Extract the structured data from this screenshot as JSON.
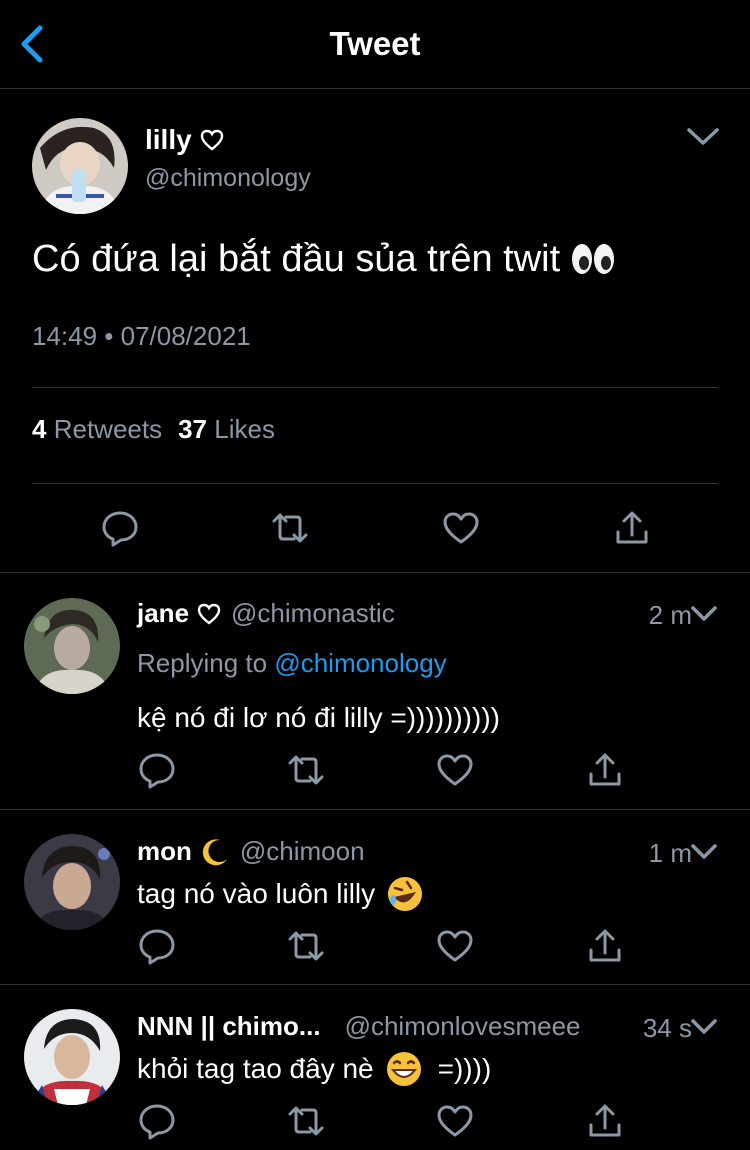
{
  "header": {
    "title": "Tweet"
  },
  "main_tweet": {
    "name": "lilly",
    "handle": "@chimonology",
    "text": "Có đứa lại bắt đầu sủa trên twit",
    "emoji": "eyes-emoji",
    "timestamp": "14:49 • 07/08/2021",
    "retweets_count": "4",
    "retweets_label": "Retweets",
    "likes_count": "37",
    "likes_label": "Likes"
  },
  "replies": [
    {
      "name": "jane",
      "handle": "@chimonastic",
      "time": "2 m",
      "replying_prefix": "Replying to",
      "replying_to": "@chimonology",
      "text": "kệ nó đi lơ nó đi lilly =))))))))))"
    },
    {
      "name": "mon",
      "handle": "@chimoon",
      "time": "1 m",
      "text": "tag nó vào luôn lilly",
      "emoji": "rofl-emoji"
    },
    {
      "name": "NNN || chimo...",
      "handle": "@chimonlovesmeee",
      "time": "34 s",
      "text_before": "khỏi tag tao đây nè",
      "emoji": "grin-emoji",
      "text_after": "=))))"
    }
  ],
  "colors": {
    "background": "#000000",
    "accent": "#1d9bf0",
    "muted": "#8b98a5",
    "divider": "#2f3336"
  }
}
